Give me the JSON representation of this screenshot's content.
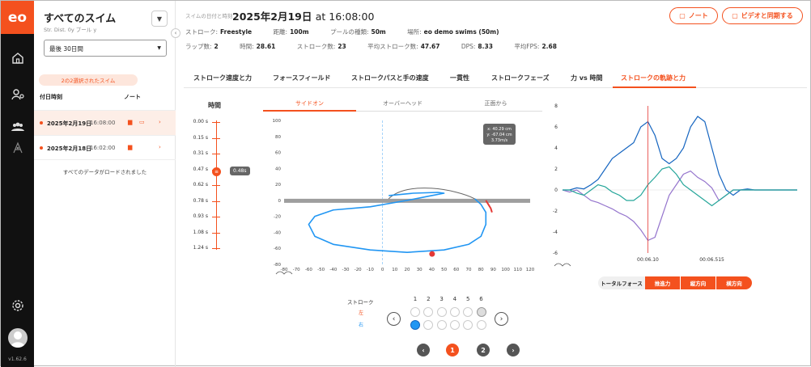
{
  "app": {
    "logo": "eo",
    "version": "v1.62.6"
  },
  "rail_icons": [
    "home-icon",
    "swimmer-icon",
    "team-icon",
    "analytics-icon",
    "settings-icon"
  ],
  "sidebar": {
    "title": "すべてのスイム",
    "subtitle": "Str.  Dist. 0y  プール y",
    "period": "最後 30日間",
    "selected_pill": "2の2選択されたスイム",
    "col_date": "付日時刻",
    "col_note": "ノート",
    "swims": [
      {
        "date": "2025年2月19日",
        "time": "16:08:00"
      },
      {
        "date": "2025年2月18日",
        "time": "16:02:00"
      }
    ],
    "loaded": "すべてのデータがロードされました"
  },
  "header": {
    "label": "スイムの日付と時刻",
    "date": "2025年2月19日",
    "at": "at 16:08:00",
    "note_btn": "ノート",
    "video_btn": "ビデオと同期する"
  },
  "meta_row1": [
    {
      "k": "ストローク:",
      "v": "Freestyle"
    },
    {
      "k": "距離:",
      "v": "100m"
    },
    {
      "k": "プールの種類:",
      "v": "50m"
    },
    {
      "k": "場所:",
      "v": "eo demo swims (50m)"
    }
  ],
  "meta_row2": [
    {
      "k": "ラップ数:",
      "v": "2"
    },
    {
      "k": "時間:",
      "v": "28.61"
    },
    {
      "k": "ストローク数:",
      "v": "23"
    },
    {
      "k": "平均ストローク数:",
      "v": "47.67"
    },
    {
      "k": "DPS:",
      "v": "8.33"
    },
    {
      "k": "平均FPS:",
      "v": "2.68"
    }
  ],
  "tabs": [
    "ストローク速度と力",
    "フォースフィールド",
    "ストロークパスと手の速度",
    "一貫性",
    "ストロークフェーズ",
    "力 vs 時間",
    "ストロークの軌跡と力"
  ],
  "time_panel": {
    "title": "時間",
    "ticks": [
      "0.00 s",
      "0.15 s",
      "0.31 s",
      "0.47 s",
      "0.62 s",
      "0.78 s",
      "0.93 s",
      "1.08 s",
      "1.24 s"
    ],
    "marker": "0.48s"
  },
  "view_tabs": [
    "サイドオン",
    "オーバーヘッド",
    "正面から"
  ],
  "trajectory_tooltip": {
    "x": "x: 40.29 cm",
    "y": "y: -67.04 cm",
    "v": "3.73m/s"
  },
  "colors": {
    "accent": "#f4511e",
    "path": "#2196f3",
    "purple": "#9575cd",
    "teal": "#26a69a",
    "dark_blue": "#1565c0"
  },
  "stroke_selector": {
    "label": "ストローク",
    "left": "左",
    "right": "右",
    "numbers": [
      "1",
      "2",
      "3",
      "4",
      "5",
      "6"
    ]
  },
  "pager": [
    "1",
    "2"
  ],
  "force_buttons": [
    "トータルフォース",
    "推進力",
    "縦方向",
    "横方向"
  ],
  "chart_data": [
    {
      "type": "line",
      "title": "",
      "x": [
        -80,
        -70,
        -60,
        -50,
        -40,
        -30,
        -20,
        -10,
        0,
        10,
        20,
        30,
        40,
        50,
        60,
        70,
        80,
        90,
        100,
        110,
        120
      ],
      "xlim": [
        -80,
        120
      ],
      "ylim": [
        -80,
        100
      ],
      "xticks": [
        "-80",
        "-70",
        "-60",
        "-50",
        "-40",
        "-30",
        "-20",
        "-10",
        "0",
        "10",
        "20",
        "30",
        "40",
        "50",
        "60",
        "70",
        "80",
        "90",
        "100",
        "110",
        "120"
      ],
      "yticks": [
        "100",
        "80",
        "60",
        "40",
        "20",
        "0",
        "-20",
        "-40",
        "-60",
        "-80"
      ],
      "series": [
        {
          "x": [
            75,
            80,
            82,
            84,
            84,
            80,
            70,
            50,
            20,
            -10,
            -40,
            -55,
            -60,
            -55,
            -40,
            -10,
            20,
            40,
            50,
            45,
            25,
            5
          ],
          "y": [
            2,
            -5,
            -10,
            -15,
            -30,
            -45,
            -55,
            -62,
            -65,
            -62,
            -55,
            -45,
            -30,
            -20,
            -12,
            -8,
            0,
            6,
            9,
            10,
            9,
            6
          ]
        },
        {
          "x": [
            84,
            86,
            88,
            89
          ],
          "y": [
            0,
            -5,
            -10,
            -15
          ]
        }
      ],
      "point": {
        "x": 40.29,
        "y": -67.04
      }
    },
    {
      "type": "line",
      "ylim": [
        -6,
        8
      ],
      "yticks": [
        "8",
        "6",
        "4",
        "2",
        "0",
        "-2",
        "-4",
        "-6"
      ],
      "xticks": [
        "00:06.10",
        "00:06.515"
      ],
      "series": [
        {
          "values": [
            0,
            0,
            0.2,
            0.1,
            0.5,
            1,
            2,
            3,
            3.5,
            4,
            4.5,
            6,
            6.5,
            5.2,
            3,
            2.5,
            3,
            4,
            6,
            7,
            6.5,
            4,
            1.5,
            0,
            -0.5,
            0,
            0.1,
            0,
            0,
            0,
            0,
            0,
            0,
            0
          ]
        },
        {
          "values": [
            0,
            -0.2,
            0,
            -0.5,
            -1,
            -1.2,
            -1.5,
            -1.8,
            -2.2,
            -2.5,
            -3,
            -3.8,
            -4.8,
            -4.5,
            -2.5,
            -0.5,
            0.5,
            1.5,
            1.8,
            1.2,
            0.8,
            0.2,
            -1,
            -0.5,
            0,
            0,
            0,
            0,
            0,
            0,
            0,
            0,
            0,
            0
          ]
        },
        {
          "values": [
            0,
            0,
            -0.3,
            -0.5,
            0,
            0.5,
            0.3,
            -0.2,
            -0.5,
            -1,
            -1,
            -0.5,
            0.5,
            1.2,
            2,
            2.2,
            1.5,
            0.5,
            0,
            -0.5,
            -1,
            -1.5,
            -1,
            -0.5,
            0,
            0,
            0,
            0,
            0,
            0,
            0,
            0,
            0,
            0
          ]
        }
      ],
      "marker_x": 12
    }
  ]
}
